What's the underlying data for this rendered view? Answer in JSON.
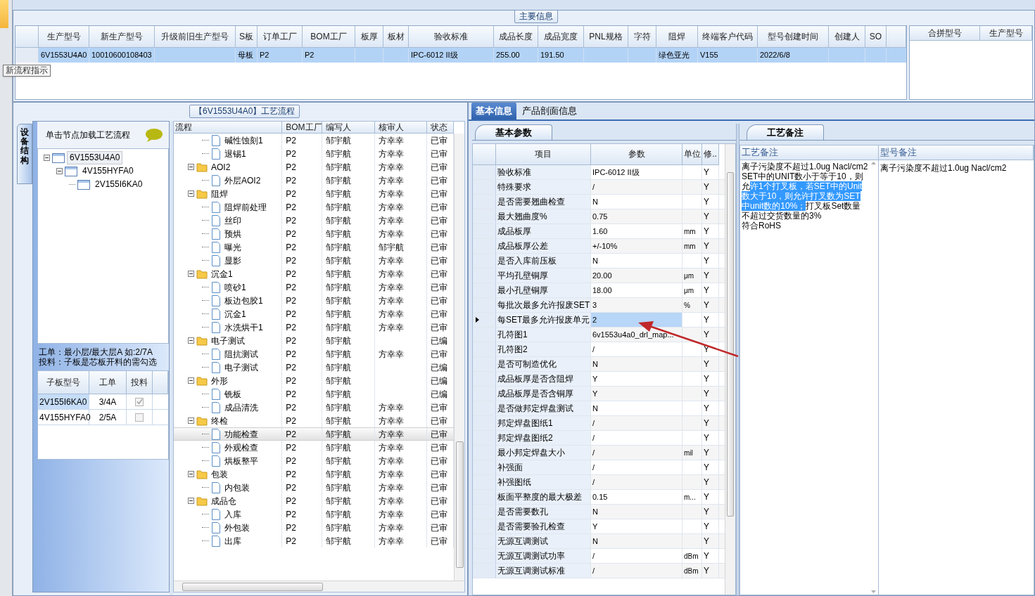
{
  "main_info": {
    "title": "主要信息",
    "columns": [
      "生产型号",
      "新生产型号",
      "升级前旧生产型号",
      "S板",
      "订单工厂",
      "BOM工厂",
      "板厚",
      "板材",
      "验收标准",
      "成品长度",
      "成品宽度",
      "PNL规格",
      "字符",
      "阻焊",
      "终端客户代码",
      "型号创建时间",
      "创建人",
      "SO"
    ],
    "rows": [
      {
        "selected": true,
        "cells": [
          "6V1553U4A0",
          "10010600108403",
          null,
          "母板",
          "P2",
          "P2",
          null,
          null,
          "IPC-6012 II级",
          "255.00",
          "191.50",
          null,
          null,
          "绿色亚光",
          "V155",
          "2022/6/8",
          null,
          null
        ]
      }
    ],
    "tooltip": "新流程指示"
  },
  "merge_grid": {
    "columns": [
      "合拼型号",
      "生产型号"
    ]
  },
  "process": {
    "title": "【6V1553U4A0】工艺流程",
    "side_tab": "设备结构",
    "hint": "单击节点加载工艺流程",
    "tree": [
      {
        "label": "6V1553U4A0",
        "selected": true,
        "expanded": true,
        "children": [
          {
            "label": "4V155HYFA0",
            "selected": false,
            "expanded": true,
            "children": [
              {
                "label": "2V155I6KA0",
                "selected": false
              }
            ]
          }
        ]
      }
    ],
    "note_lines": [
      "工单：最小层/最大层A 如:2/7A",
      "投料：子板是芯板开料的需勾选"
    ],
    "sub_boards": {
      "columns": [
        "子板型号",
        "工单",
        "投料"
      ],
      "rows": [
        {
          "model": "2V155I6KA0",
          "order": "3/4A",
          "checked": true,
          "selected": true
        },
        {
          "model": "4V155HYFA0",
          "order": "2/5A",
          "checked": false,
          "selected": false
        }
      ]
    }
  },
  "flow": {
    "columns": [
      "流程",
      "BOM工厂",
      "编写人",
      "核审人",
      "状态"
    ],
    "nodes": [
      {
        "kind": "hidden_parent",
        "children": [
          {
            "kind": "leaf",
            "label": "碱性蚀刻1",
            "bom": "P2",
            "writer": "邹宇航",
            "reviewer": "方幸幸",
            "status": "已审",
            "selected": false
          },
          {
            "kind": "leaf",
            "label": "退锡1",
            "bom": "P2",
            "writer": "邹宇航",
            "reviewer": "方幸幸",
            "status": "已审",
            "selected": false
          }
        ]
      },
      {
        "kind": "folder",
        "label": "AOI2",
        "bom": "P2",
        "writer": "邹宇航",
        "reviewer": "方幸幸",
        "status": "已审",
        "selected": false,
        "expanded": true,
        "children": [
          {
            "kind": "leaf",
            "label": "外层AOI2",
            "bom": "P2",
            "writer": "邹宇航",
            "reviewer": "方幸幸",
            "status": "已审",
            "selected": false
          }
        ]
      },
      {
        "kind": "folder",
        "label": "阻焊",
        "bom": "P2",
        "writer": "邹宇航",
        "reviewer": "方幸幸",
        "status": "已审",
        "selected": false,
        "expanded": true,
        "children": [
          {
            "kind": "leaf",
            "label": "阻焊前处理",
            "bom": "P2",
            "writer": "邹宇航",
            "reviewer": "方幸幸",
            "status": "已审",
            "selected": false
          },
          {
            "kind": "leaf",
            "label": "丝印",
            "bom": "P2",
            "writer": "邹宇航",
            "reviewer": "方幸幸",
            "status": "已审",
            "selected": false
          },
          {
            "kind": "leaf",
            "label": "预烘",
            "bom": "P2",
            "writer": "邹宇航",
            "reviewer": "方幸幸",
            "status": "已审",
            "selected": false
          },
          {
            "kind": "leaf",
            "label": "曝光",
            "bom": "P2",
            "writer": "邹宇航",
            "reviewer": "邹宇航",
            "status": "已审",
            "selected": false
          },
          {
            "kind": "leaf",
            "label": "显影",
            "bom": "P2",
            "writer": "邹宇航",
            "reviewer": "方幸幸",
            "status": "已审",
            "selected": false
          }
        ]
      },
      {
        "kind": "folder",
        "label": "沉金1",
        "bom": "P2",
        "writer": "邹宇航",
        "reviewer": "方幸幸",
        "status": "已审",
        "selected": false,
        "expanded": true,
        "children": [
          {
            "kind": "leaf",
            "label": "喷砂1",
            "bom": "P2",
            "writer": "邹宇航",
            "reviewer": "方幸幸",
            "status": "已审",
            "selected": false
          },
          {
            "kind": "leaf",
            "label": "板边包胶1",
            "bom": "P2",
            "writer": "邹宇航",
            "reviewer": "方幸幸",
            "status": "已审",
            "selected": false
          },
          {
            "kind": "leaf",
            "label": "沉金1",
            "bom": "P2",
            "writer": "邹宇航",
            "reviewer": "方幸幸",
            "status": "已审",
            "selected": false
          },
          {
            "kind": "leaf",
            "label": "水洗烘干1",
            "bom": "P2",
            "writer": "邹宇航",
            "reviewer": "方幸幸",
            "status": "已审",
            "selected": false
          }
        ]
      },
      {
        "kind": "folder",
        "label": "电子测试",
        "bom": "P2",
        "writer": "邹宇航",
        "status": "已编",
        "selected": false,
        "expanded": true,
        "children": [
          {
            "kind": "leaf",
            "label": "阻抗测试",
            "bom": "P2",
            "writer": "邹宇航",
            "reviewer": "方幸幸",
            "status": "已审",
            "selected": false
          },
          {
            "kind": "leaf",
            "label": "电子测试",
            "bom": "P2",
            "writer": "邹宇航",
            "status": "已编",
            "selected": false
          }
        ]
      },
      {
        "kind": "folder",
        "label": "外形",
        "bom": "P2",
        "writer": "邹宇航",
        "status": "已编",
        "selected": false,
        "expanded": true,
        "children": [
          {
            "kind": "leaf",
            "label": "铣板",
            "bom": "P2",
            "writer": "邹宇航",
            "status": "已编",
            "selected": false
          },
          {
            "kind": "leaf",
            "label": "成品清洗",
            "bom": "P2",
            "writer": "邹宇航",
            "reviewer": "方幸幸",
            "status": "已审",
            "selected": false
          }
        ]
      },
      {
        "kind": "folder",
        "label": "终检",
        "bom": "P2",
        "writer": "邹宇航",
        "reviewer": "方幸幸",
        "status": "已审",
        "selected": false,
        "expanded": true,
        "children": [
          {
            "kind": "leaf",
            "label": "功能检查",
            "bom": "P2",
            "writer": "邹宇航",
            "reviewer": "方幸幸",
            "status": "已审",
            "selected": true
          },
          {
            "kind": "leaf",
            "label": "外观检查",
            "bom": "P2",
            "writer": "邹宇航",
            "reviewer": "方幸幸",
            "status": "已审",
            "selected": false
          },
          {
            "kind": "leaf",
            "label": "烘板整平",
            "bom": "P2",
            "writer": "邹宇航",
            "reviewer": "方幸幸",
            "status": "已审",
            "selected": false
          }
        ]
      },
      {
        "kind": "folder",
        "label": "包装",
        "bom": "P2",
        "writer": "邹宇航",
        "reviewer": "方幸幸",
        "status": "已审",
        "selected": false,
        "expanded": true,
        "children": [
          {
            "kind": "leaf",
            "label": "内包装",
            "bom": "P2",
            "writer": "邹宇航",
            "reviewer": "方幸幸",
            "status": "已审",
            "selected": false
          }
        ]
      },
      {
        "kind": "folder",
        "label": "成品仓",
        "bom": "P2",
        "writer": "邹宇航",
        "reviewer": "方幸幸",
        "status": "已审",
        "selected": false,
        "expanded": true,
        "children": [
          {
            "kind": "leaf",
            "label": "入库",
            "bom": "P2",
            "writer": "邹宇航",
            "reviewer": "方幸幸",
            "status": "已审",
            "selected": false
          },
          {
            "kind": "leaf",
            "label": "外包装",
            "bom": "P2",
            "writer": "邹宇航",
            "reviewer": "方幸幸",
            "status": "已审",
            "selected": false
          },
          {
            "kind": "leaf",
            "label": "出库",
            "bom": "P2",
            "writer": "邹宇航",
            "reviewer": "方幸幸",
            "status": "已审",
            "selected": false
          }
        ]
      }
    ]
  },
  "info_tabs": [
    {
      "label": "基本信息",
      "selected": true
    },
    {
      "label": "产品剖面信息",
      "selected": false
    }
  ],
  "params": {
    "tab": "基本参数",
    "columns": [
      "项目",
      "参数",
      "单位",
      "修.."
    ],
    "rows": [
      {
        "item": "验收标准",
        "value": "IPC-6012 II级",
        "mod": "Y",
        "current": false
      },
      {
        "item": "特殊要求",
        "value": "/",
        "mod": "Y",
        "current": false
      },
      {
        "item": "是否需要翘曲检查",
        "value": "N",
        "mod": "Y",
        "current": false
      },
      {
        "item": "最大翘曲度%",
        "value": "0.75",
        "mod": "Y",
        "current": false
      },
      {
        "item": "成品板厚",
        "value": "1.60",
        "unit": "mm",
        "mod": "Y",
        "current": false
      },
      {
        "item": "成品板厚公差",
        "value": "+/-10%",
        "unit": "mm",
        "mod": "Y",
        "current": false
      },
      {
        "item": "是否入库前压板",
        "value": "N",
        "mod": "Y",
        "current": false
      },
      {
        "item": "平均孔壁铜厚",
        "value": "20.00",
        "unit": "μm",
        "mod": "Y",
        "current": false
      },
      {
        "item": "最小孔壁铜厚",
        "value": "18.00",
        "unit": "μm",
        "mod": "Y",
        "current": false
      },
      {
        "item": "每批次最多允许报废SET",
        "value": "3",
        "unit": "%",
        "mod": "Y",
        "current": false
      },
      {
        "item": "每SET最多允许报废单元",
        "value": "2",
        "mod": "Y",
        "current": true
      },
      {
        "item": "孔符图1",
        "value": "6v1553u4a0_drl_map...",
        "mod": "Y",
        "current": false
      },
      {
        "item": "孔符图2",
        "value": "/",
        "mod": "Y",
        "current": false
      },
      {
        "item": "是否可制造优化",
        "value": "N",
        "mod": "Y",
        "current": false
      },
      {
        "item": "成品板厚是否含阻焊",
        "value": "Y",
        "mod": "Y",
        "current": false
      },
      {
        "item": "成品板厚是否含铜厚",
        "value": "Y",
        "mod": "Y",
        "current": false
      },
      {
        "item": "是否做邦定焊盘测试",
        "value": "N",
        "mod": "Y",
        "current": false
      },
      {
        "item": "邦定焊盘图纸1",
        "value": "/",
        "mod": "Y",
        "current": false
      },
      {
        "item": "邦定焊盘图纸2",
        "value": "/",
        "mod": "Y",
        "current": false
      },
      {
        "item": "最小邦定焊盘大小",
        "value": "/",
        "unit": "mil",
        "mod": "Y",
        "current": false
      },
      {
        "item": "补强面",
        "value": "/",
        "mod": "Y",
        "current": false
      },
      {
        "item": "补强图纸",
        "value": "/",
        "mod": "Y",
        "current": false
      },
      {
        "item": "板面平整度的最大极差",
        "value": "0.15",
        "unit": "m...",
        "mod": "Y",
        "current": false
      },
      {
        "item": "是否需要数孔",
        "value": "N",
        "mod": "Y",
        "current": false
      },
      {
        "item": "是否需要验孔检查",
        "value": "Y",
        "mod": "Y",
        "current": false
      },
      {
        "item": "无源互调测试",
        "value": "N",
        "mod": "Y",
        "current": false
      },
      {
        "item": "无源互调测试功率",
        "value": "/",
        "unit": "dBm",
        "mod": "Y",
        "current": false
      },
      {
        "item": "无源互调测试标准",
        "value": "/",
        "unit": "dBm",
        "mod": "Y",
        "current": false
      }
    ]
  },
  "remarks": {
    "tab": "工艺备注",
    "columns": [
      "工艺备注",
      "型号备注"
    ],
    "process_note": [
      {
        "parts": [
          {
            "text": "离子污染度不超过1.0ug Nacl/cm2",
            "selected": false
          }
        ]
      },
      {
        "parts": [
          {
            "text": "SET中的UNIT数小于等于10，则允",
            "selected": false
          },
          {
            "text": "许1个打叉板，若SET中的Unit数大于10，则允许打叉数为SET中unit数的10%；",
            "selected": true
          },
          {
            "text": "打叉板Set数量不超过交货数量的3%",
            "selected": false
          }
        ]
      },
      {
        "parts": [
          {
            "text": "符合RoHS",
            "selected": false
          }
        ]
      }
    ],
    "model_note": "离子污染度不超过1.0ug Nacl/cm2"
  }
}
